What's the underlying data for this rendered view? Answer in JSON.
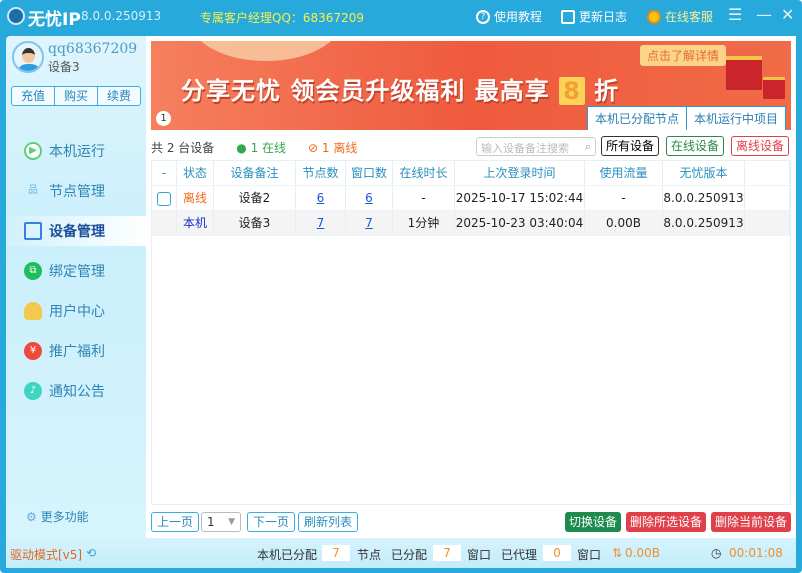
{
  "title": {
    "app_name": "无忧IP",
    "version": "8.0.0.250913",
    "manager_qq": "专属客户经理QQ：68367209",
    "tutorial": "使用教程",
    "changelog": "更新日志",
    "support": "在线客服"
  },
  "user": {
    "name": "qq68367209",
    "device": "设备3",
    "buttons": [
      "充值",
      "购买",
      "续费"
    ]
  },
  "nav": [
    {
      "label": "本机运行"
    },
    {
      "label": "节点管理"
    },
    {
      "label": "设备管理"
    },
    {
      "label": "绑定管理"
    },
    {
      "label": "用户中心"
    },
    {
      "label": "推广福利"
    },
    {
      "label": "通知公告"
    }
  ],
  "more": "更多功能",
  "banner": {
    "text": "分享无忧 领会员升级福利 最高享",
    "eight": "8",
    "zhe": "折",
    "detail": "点击了解详情",
    "page": "1",
    "tabs": [
      "本机已分配节点",
      "本机运行中项目"
    ]
  },
  "toolbar": {
    "count": "共 2 台设备",
    "online": "1 在线",
    "offline": "1 离线",
    "search_placeholder": "输入设备备注搜索",
    "all": "所有设备",
    "online_btn": "在线设备",
    "offline_btn": "离线设备"
  },
  "table": {
    "headers": [
      "-",
      "状态",
      "设备备注",
      "节点数",
      "窗口数",
      "在线时长",
      "上次登录时间",
      "使用流量",
      "无忧版本"
    ],
    "rows": [
      {
        "status": "离线",
        "note": "设备2",
        "nodes": "6",
        "windows": "6",
        "duration": "-",
        "last_login": "2025-10-17 15:02:44",
        "traffic": "-",
        "version": "8.0.0.250913"
      },
      {
        "status": "本机",
        "note": "设备3",
        "nodes": "7",
        "windows": "7",
        "duration": "1分钟",
        "last_login": "2025-10-23 03:40:04",
        "traffic": "0.00B",
        "version": "8.0.0.250913"
      }
    ]
  },
  "footer": {
    "prev": "上一页",
    "page": "1",
    "next": "下一页",
    "refresh": "刷新列表",
    "switch": "切换设备",
    "delete_selected": "删除所选设备",
    "delete_current": "删除当前设备"
  },
  "status": {
    "mode": "驱动模式[v5]",
    "l1": "本机已分配",
    "v1": "7",
    "l2": "节点",
    "l3": "已分配",
    "v2": "7",
    "l4": "窗口",
    "l5": "已代理",
    "v3": "0",
    "l6": "窗口",
    "traffic": "0.00B",
    "time": "00:01:08"
  }
}
